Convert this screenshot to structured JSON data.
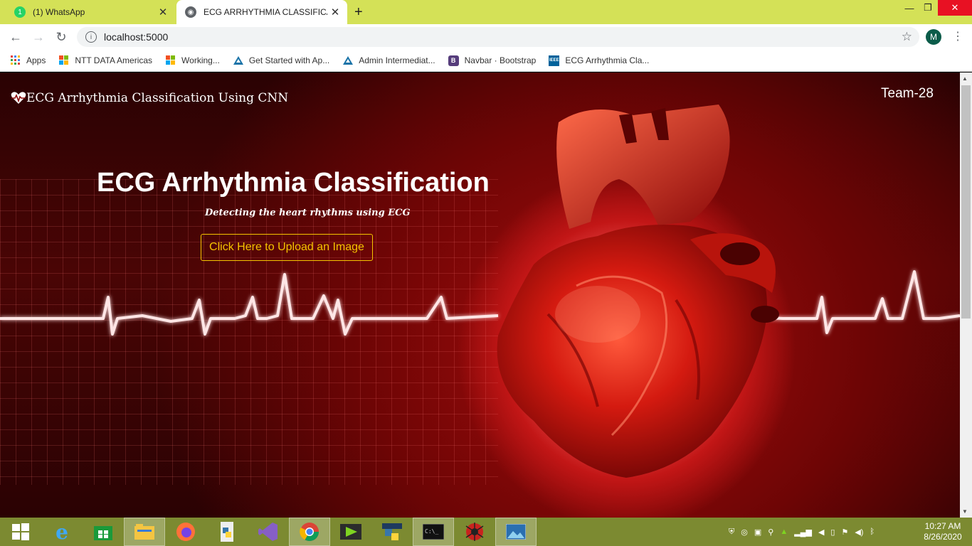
{
  "browser": {
    "tabs": [
      {
        "title": "(1) WhatsApp",
        "badge": "1"
      },
      {
        "title": "ECG ARRHYTHMIA CLASSIFICATIO"
      }
    ],
    "new_tab": "+",
    "url": "localhost:5000",
    "profile_initial": "M",
    "bookmarks": [
      {
        "label": "Apps",
        "icon": "apps-grid-icon"
      },
      {
        "label": "NTT DATA Americas",
        "icon": "windows-logo-icon"
      },
      {
        "label": "Working...",
        "icon": "windows-logo-icon"
      },
      {
        "label": "Get Started with Ap...",
        "icon": "mountain-icon"
      },
      {
        "label": "Admin Intermediat...",
        "icon": "mountain-icon"
      },
      {
        "label": "Navbar · Bootstrap",
        "icon": "bootstrap-icon"
      },
      {
        "label": "ECG Arrhythmia Cla...",
        "icon": "ieee-icon"
      }
    ]
  },
  "page": {
    "brand": "ECG Arrhythmia Classification Using CNN",
    "team": "Team-28",
    "hero_title": "ECG Arrhythmia Classification",
    "hero_subtitle": "Detecting the heart rhythms using ECG",
    "upload_button": "Click Here to Upload an Image",
    "colors": {
      "accent": "#f5c400",
      "background": "#8b0a0a"
    }
  },
  "taskbar": {
    "time": "10:27 AM",
    "date": "8/26/2020",
    "apps": [
      "start-icon",
      "internet-explorer-icon",
      "store-icon",
      "file-explorer-icon",
      "firefox-icon",
      "python-idle-icon",
      "visual-studio-icon",
      "chrome-icon",
      "media-player-icon",
      "python-icon",
      "terminal-icon",
      "spider-icon",
      "photos-icon"
    ]
  }
}
